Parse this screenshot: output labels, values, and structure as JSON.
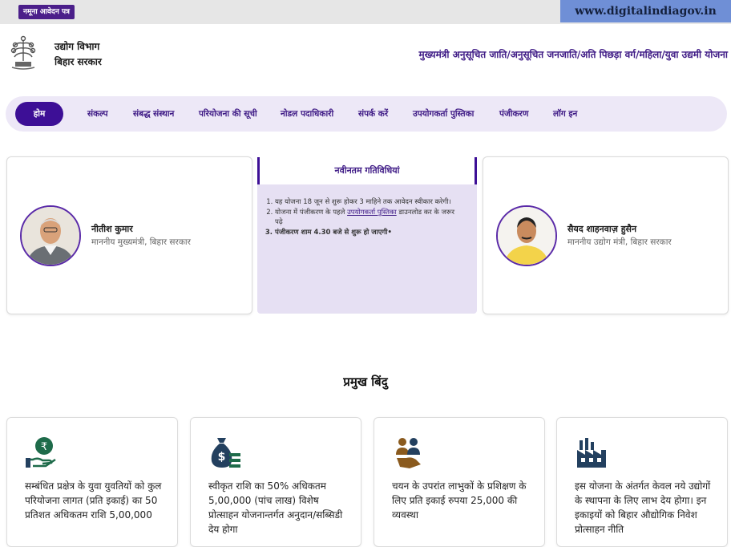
{
  "topbar": {
    "sample_label": "नमूना आवेदन पत्र",
    "site_url": "www.digitalindiagov.in"
  },
  "header": {
    "dept_line1": "उद्योग विभाग",
    "dept_line2": "बिहार सरकार",
    "scheme_title": "मुख्यमंत्री अनुसूचित जाति/अनुसूचित जनजाति/अति पिछड़ा वर्ग/महिला/युवा उद्यमी योजना",
    "emblem_icon": "bihar-emblem-icon"
  },
  "nav": {
    "items": [
      "होम",
      "संकल्प",
      "संबद्ध संस्थान",
      "परियोजना की सूची",
      "नोडल पदाधिकारी",
      "संपर्क करें",
      "उपयोगकर्ता पुस्तिका",
      "पंजीकरण",
      "लॉग इन"
    ],
    "active": "होम"
  },
  "people": {
    "left": {
      "name": "नीतीश कुमार",
      "role": "माननीय मुख्यमंत्री, बिहार सरकार"
    },
    "right": {
      "name": "सैयद शाहनवाज़ हुसैन",
      "role": "माननीय उद्योग मंत्री, बिहार सरकार"
    }
  },
  "news": {
    "title": "नवीनतम गतिविधियां",
    "items": [
      {
        "text": "यह योजना 18 जून से शुरू होकर 3 माहिने तक आवेदन स्वीकार करेगी।"
      },
      {
        "pre": "योजना में पंजीकरण के पहले ",
        "link": "उपयोगकर्ता पुस्तिका",
        "post": " डाउनलोड कर के जरूर पढ़े"
      },
      {
        "text": "पंजीकरण शाम 4.30 बजे से शुरू हो जाएगी•"
      }
    ]
  },
  "highlights": {
    "title": "प्रमुख बिंदु",
    "cards": [
      {
        "icon": "rupee-hand-icon",
        "text": "सम्बंधित प्रक्षेत्र के युवा युवतियों को कुल परियोजना लागत (प्रति इकाई) का 50 प्रतिशत अधिकतम राशि 5,00,000"
      },
      {
        "icon": "money-bag-icon",
        "text": "स्वीकृत राशि का 50% अधिकतम 5,00,000 (पांच लाख) विशेष प्रोत्साहन योजनान्तर्गत अनुदान/सब्सिडी देय होगा"
      },
      {
        "icon": "hand-people-icon",
        "text": "चयन के उपरांत लाभुकों के प्रशिक्षण के लिए प्रति इकाई रुपया 25,000 की व्यवस्था"
      },
      {
        "icon": "factory-icon",
        "text": "इस योजना के अंतर्गत केवल नये उद्योगों के स्थापना के लिए लाभ देय होगा। इन इकाइयों को बिहार औद्योगिक निवेश प्रोत्साहन नीति"
      }
    ]
  },
  "colors": {
    "brand_purple": "#3d0f96",
    "nav_bg": "#ede8f7",
    "news_bg": "#e6e0f3",
    "url_bg": "#6f8fd6",
    "icon_green": "#1e6b4a",
    "icon_blue": "#23405f",
    "icon_brown": "#8a5a1e"
  }
}
